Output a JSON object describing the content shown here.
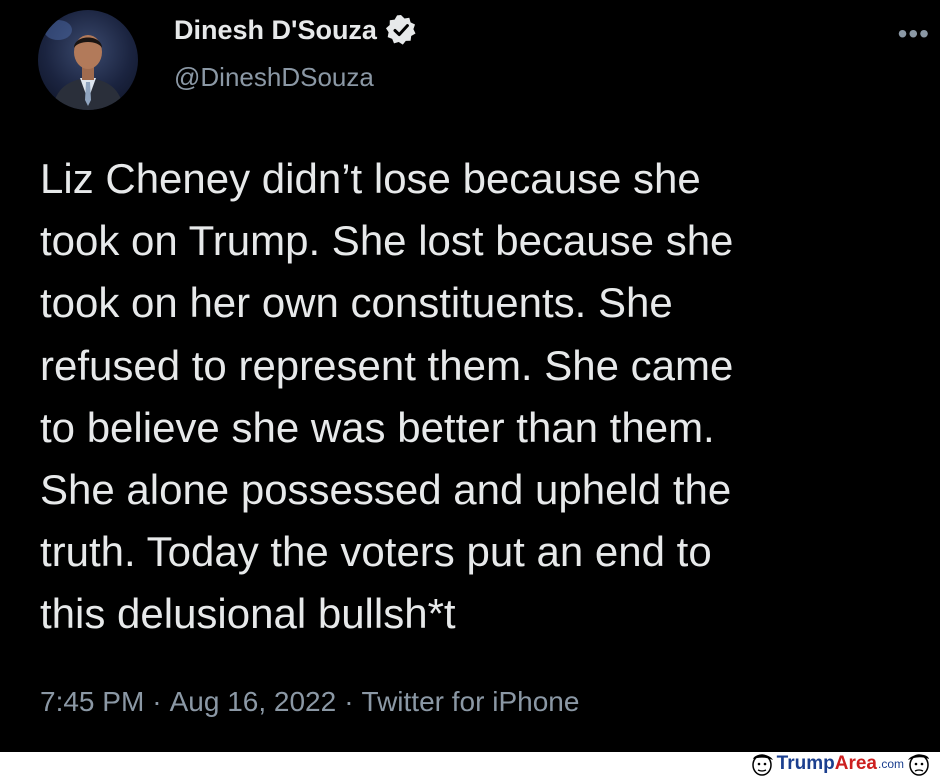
{
  "author": {
    "display_name": "Dinesh D'Souza",
    "handle": "@DineshDSouza",
    "verified": true
  },
  "menu": {
    "more_icon": "more-horizontal-icon",
    "more_glyph": "•••"
  },
  "tweet": {
    "text": "Liz Cheney didn’t lose because she\ntook on Trump. She lost because she\ntook on her own constituents. She\nrefused to represent them. She came\nto believe she was better than them.\nShe alone possessed and upheld the\ntruth. Today the voters put an end to\nthis delusional bullsh*t",
    "time": "7:45 PM",
    "date": "Aug 16, 2022",
    "source": "Twitter for iPhone",
    "separator": "·"
  },
  "watermark": {
    "part1": "Trump",
    "part2": "Area",
    "part3": ".com"
  },
  "colors": {
    "background": "#000000",
    "text": "#e7e9ea",
    "secondary": "#8b98a5",
    "verified_badge": "#e7e9ea",
    "watermark_blue": "#1b3f8f",
    "watermark_red": "#cc1f1f"
  }
}
